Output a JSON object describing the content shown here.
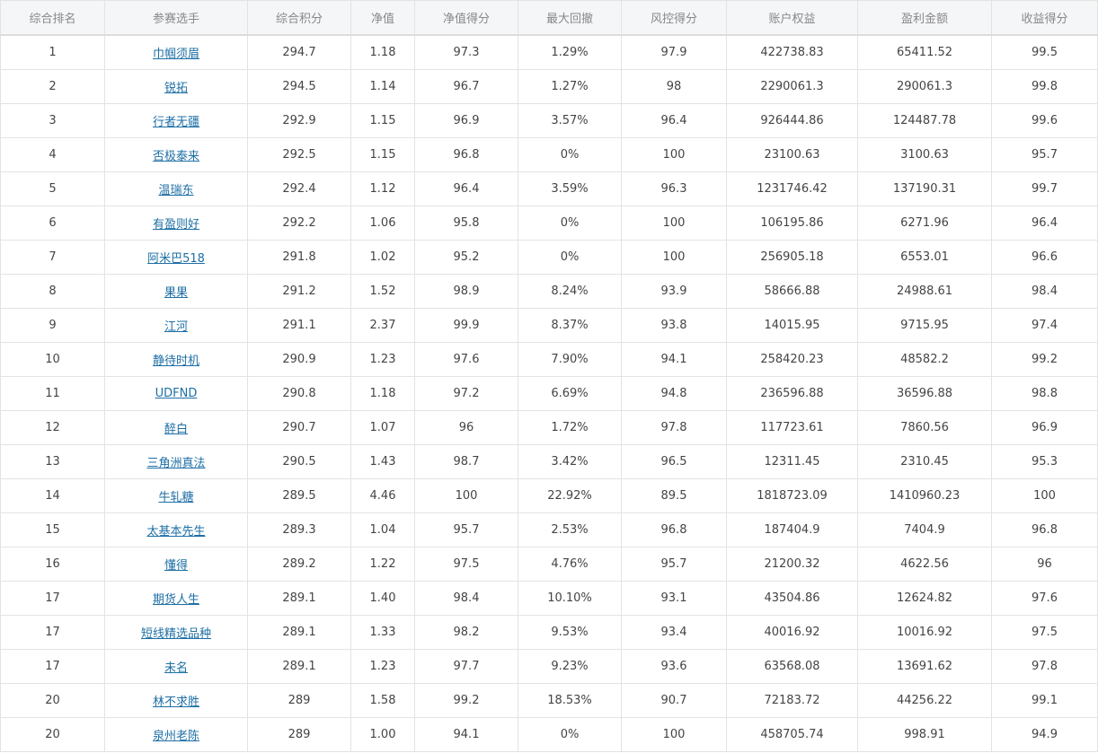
{
  "columns": [
    "综合排名",
    "参赛选手",
    "综合积分",
    "净值",
    "净值得分",
    "最大回撤",
    "风控得分",
    "账户权益",
    "盈利金额",
    "收益得分"
  ],
  "rows": [
    [
      "1",
      "巾帼须眉",
      "294.7",
      "1.18",
      "97.3",
      "1.29%",
      "97.9",
      "422738.83",
      "65411.52",
      "99.5"
    ],
    [
      "2",
      "锐拓",
      "294.5",
      "1.14",
      "96.7",
      "1.27%",
      "98",
      "2290061.3",
      "290061.3",
      "99.8"
    ],
    [
      "3",
      "行者无疆",
      "292.9",
      "1.15",
      "96.9",
      "3.57%",
      "96.4",
      "926444.86",
      "124487.78",
      "99.6"
    ],
    [
      "4",
      "否极泰来",
      "292.5",
      "1.15",
      "96.8",
      "0%",
      "100",
      "23100.63",
      "3100.63",
      "95.7"
    ],
    [
      "5",
      "温瑞东",
      "292.4",
      "1.12",
      "96.4",
      "3.59%",
      "96.3",
      "1231746.42",
      "137190.31",
      "99.7"
    ],
    [
      "6",
      "有盈则好",
      "292.2",
      "1.06",
      "95.8",
      "0%",
      "100",
      "106195.86",
      "6271.96",
      "96.4"
    ],
    [
      "7",
      "阿米巴518",
      "291.8",
      "1.02",
      "95.2",
      "0%",
      "100",
      "256905.18",
      "6553.01",
      "96.6"
    ],
    [
      "8",
      "果果",
      "291.2",
      "1.52",
      "98.9",
      "8.24%",
      "93.9",
      "58666.88",
      "24988.61",
      "98.4"
    ],
    [
      "9",
      "江河",
      "291.1",
      "2.37",
      "99.9",
      "8.37%",
      "93.8",
      "14015.95",
      "9715.95",
      "97.4"
    ],
    [
      "10",
      "静待时机",
      "290.9",
      "1.23",
      "97.6",
      "7.90%",
      "94.1",
      "258420.23",
      "48582.2",
      "99.2"
    ],
    [
      "11",
      "UDFND",
      "290.8",
      "1.18",
      "97.2",
      "6.69%",
      "94.8",
      "236596.88",
      "36596.88",
      "98.8"
    ],
    [
      "12",
      "醉白",
      "290.7",
      "1.07",
      "96",
      "1.72%",
      "97.8",
      "117723.61",
      "7860.56",
      "96.9"
    ],
    [
      "13",
      "三角洲真法",
      "290.5",
      "1.43",
      "98.7",
      "3.42%",
      "96.5",
      "12311.45",
      "2310.45",
      "95.3"
    ],
    [
      "14",
      "牛轧糖",
      "289.5",
      "4.46",
      "100",
      "22.92%",
      "89.5",
      "1818723.09",
      "1410960.23",
      "100"
    ],
    [
      "15",
      "太基本先生",
      "289.3",
      "1.04",
      "95.7",
      "2.53%",
      "96.8",
      "187404.9",
      "7404.9",
      "96.8"
    ],
    [
      "16",
      "懂得",
      "289.2",
      "1.22",
      "97.5",
      "4.76%",
      "95.7",
      "21200.32",
      "4622.56",
      "96"
    ],
    [
      "17",
      "期货人生",
      "289.1",
      "1.40",
      "98.4",
      "10.10%",
      "93.1",
      "43504.86",
      "12624.82",
      "97.6"
    ],
    [
      "17",
      "短线精选品种",
      "289.1",
      "1.33",
      "98.2",
      "9.53%",
      "93.4",
      "40016.92",
      "10016.92",
      "97.5"
    ],
    [
      "17",
      "未名",
      "289.1",
      "1.23",
      "97.7",
      "9.23%",
      "93.6",
      "63568.08",
      "13691.62",
      "97.8"
    ],
    [
      "20",
      "林不求胜",
      "289",
      "1.58",
      "99.2",
      "18.53%",
      "90.7",
      "72183.72",
      "44256.22",
      "99.1"
    ],
    [
      "20",
      "泉州老陈",
      "289",
      "1.00",
      "94.1",
      "0%",
      "100",
      "458705.74",
      "998.91",
      "94.9"
    ]
  ],
  "link_color": "#1d6fa5",
  "header_bg": "#f5f6f8"
}
